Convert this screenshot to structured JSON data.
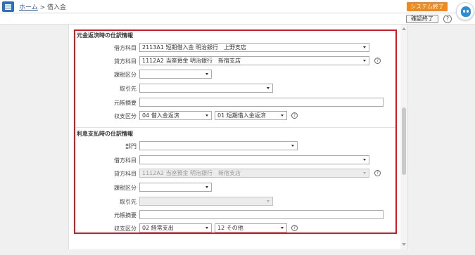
{
  "header": {
    "home_link": "ホーム",
    "separator": ">",
    "current_page": "借入金",
    "system_end_label": "システム終了"
  },
  "subbar": {
    "confirm_label": "確認終了",
    "help_symbol": "?"
  },
  "section1": {
    "title": "元金返済時の仕訳情報",
    "debit_label": "借方科目",
    "debit_value": "2113A1 短期借入金 明治銀行　上野支店",
    "credit_label": "貸方科目",
    "credit_value": "1112A2 当座預金 明治銀行　新宿支店",
    "tax_label": "課税区分",
    "tax_value": "",
    "partner_label": "取引先",
    "partner_value": "",
    "memo_label": "元帳摘要",
    "memo_value": "",
    "io_label": "収支区分",
    "io_value1": "04 借入金返済",
    "io_value2": "01 短期借入金返済"
  },
  "section2": {
    "title": "利息支払時の仕訳情報",
    "dept_label": "部門",
    "dept_value": "",
    "debit_label": "借方科目",
    "debit_value": "",
    "credit_label": "貸方科目",
    "credit_value": "1112A2 当座預金 明治銀行　新宿支店",
    "tax_label": "課税区分",
    "tax_value": "",
    "partner_label": "取引先",
    "partner_value": "",
    "memo_label": "元帳摘要",
    "memo_value": "",
    "io_label": "収支区分",
    "io_value1": "02 経常支出",
    "io_value2": "12 その他"
  },
  "help_symbol": "?",
  "colors": {
    "accent_blue": "#2c6fbe",
    "system_end_orange": "#f08a1e",
    "highlight_red": "#e3141b"
  }
}
